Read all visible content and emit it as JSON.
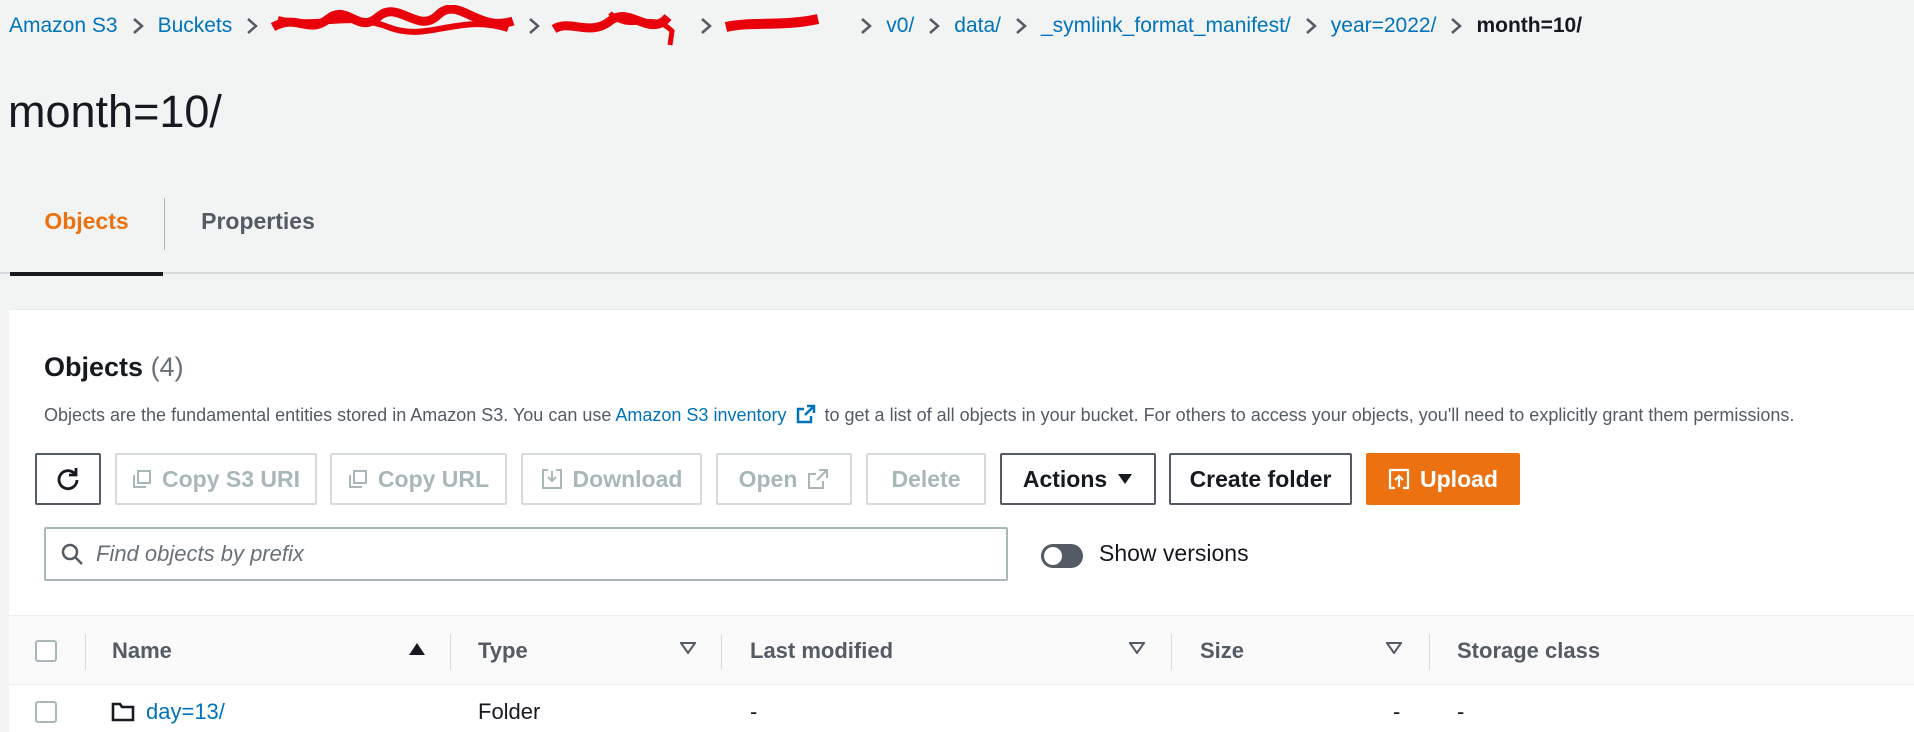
{
  "breadcrumb": {
    "items": [
      "Amazon S3",
      "Buckets",
      "v0/",
      "data/",
      "_symlink_format_manifest/",
      "year=2022/"
    ],
    "current": "month=10/"
  },
  "page_title": "month=10/",
  "tabs": [
    {
      "label": "Objects",
      "active": true
    },
    {
      "label": "Properties",
      "active": false
    }
  ],
  "objects_panel": {
    "title": "Objects",
    "count": "(4)",
    "description_before": "Objects are the fundamental entities stored in Amazon S3. You can use",
    "description_link": "Amazon S3 inventory",
    "description_after": "to get a list of all objects in your bucket. For others to access your objects, you'll need to explicitly grant them permissions."
  },
  "toolbar": {
    "copy_s3_uri": "Copy S3 URI",
    "copy_url": "Copy URL",
    "download": "Download",
    "open": "Open",
    "delete": "Delete",
    "actions": "Actions",
    "create_folder": "Create folder",
    "upload": "Upload"
  },
  "search": {
    "placeholder": "Find objects by prefix",
    "value": ""
  },
  "show_versions": {
    "label": "Show versions",
    "enabled": false
  },
  "table": {
    "columns": [
      "Name",
      "Type",
      "Last modified",
      "Size",
      "Storage class"
    ],
    "rows": [
      {
        "name": "day=13/",
        "type": "Folder",
        "last_modified": "-",
        "size": "-",
        "storage_class": "-"
      }
    ]
  },
  "colors": {
    "accent": "#ec7211",
    "link": "#0073bb",
    "text": "#16191f"
  }
}
